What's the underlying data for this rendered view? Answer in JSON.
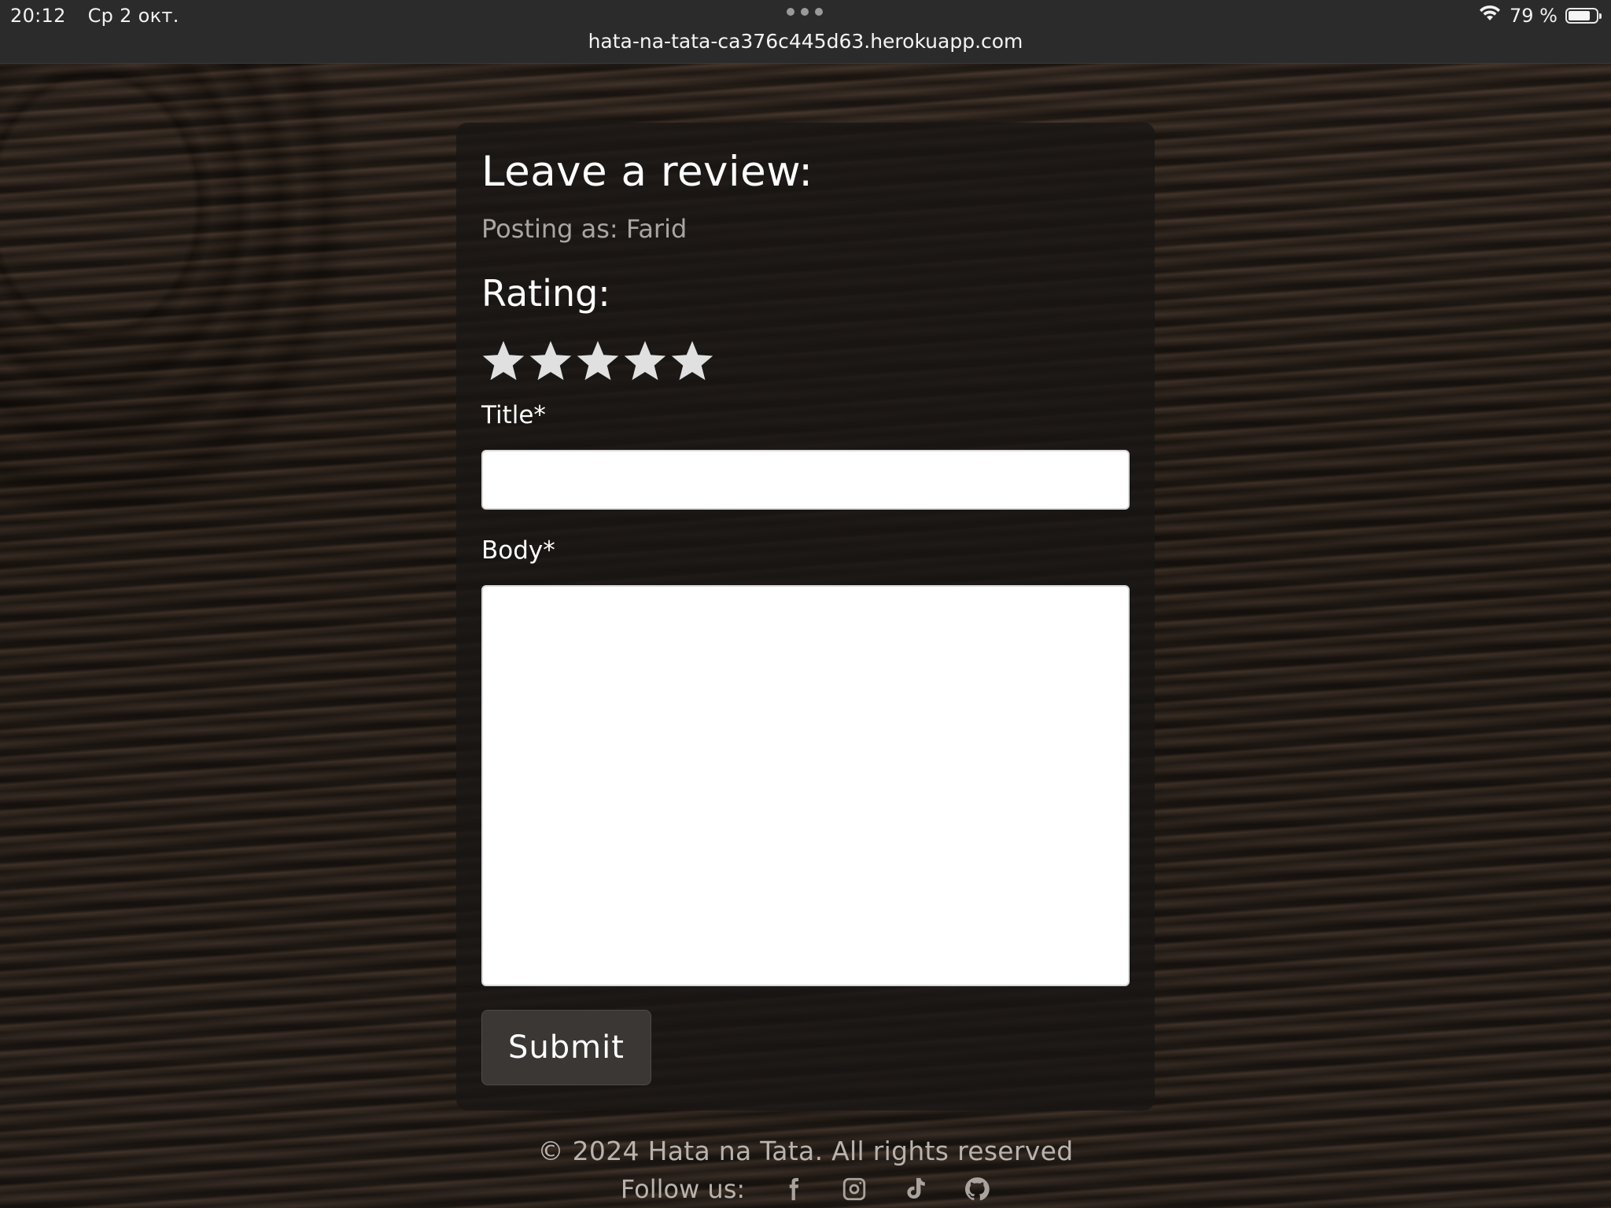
{
  "status_bar": {
    "time": "20:12",
    "date": "Ср 2 окт.",
    "battery_text": "79 %",
    "battery_level": 0.79
  },
  "browser": {
    "url": "hata-na-tata-ca376c445d63.herokuapp.com"
  },
  "review_form": {
    "heading": "Leave a review:",
    "posting_as": "Posting as: Farid",
    "rating_heading": "Rating:",
    "stars_total": 5,
    "star_glyph": "★",
    "star_color": "#e0e0e0",
    "title_label": "Title*",
    "title_value": "",
    "body_label": "Body*",
    "body_value": "",
    "submit_label": "Submit"
  },
  "footer": {
    "copyright": "© 2024 Hata na Tata. All rights reserved",
    "follow_label": "Follow us:",
    "social_icons": [
      "facebook-icon",
      "instagram-icon",
      "tiktok-icon",
      "github-icon"
    ]
  }
}
